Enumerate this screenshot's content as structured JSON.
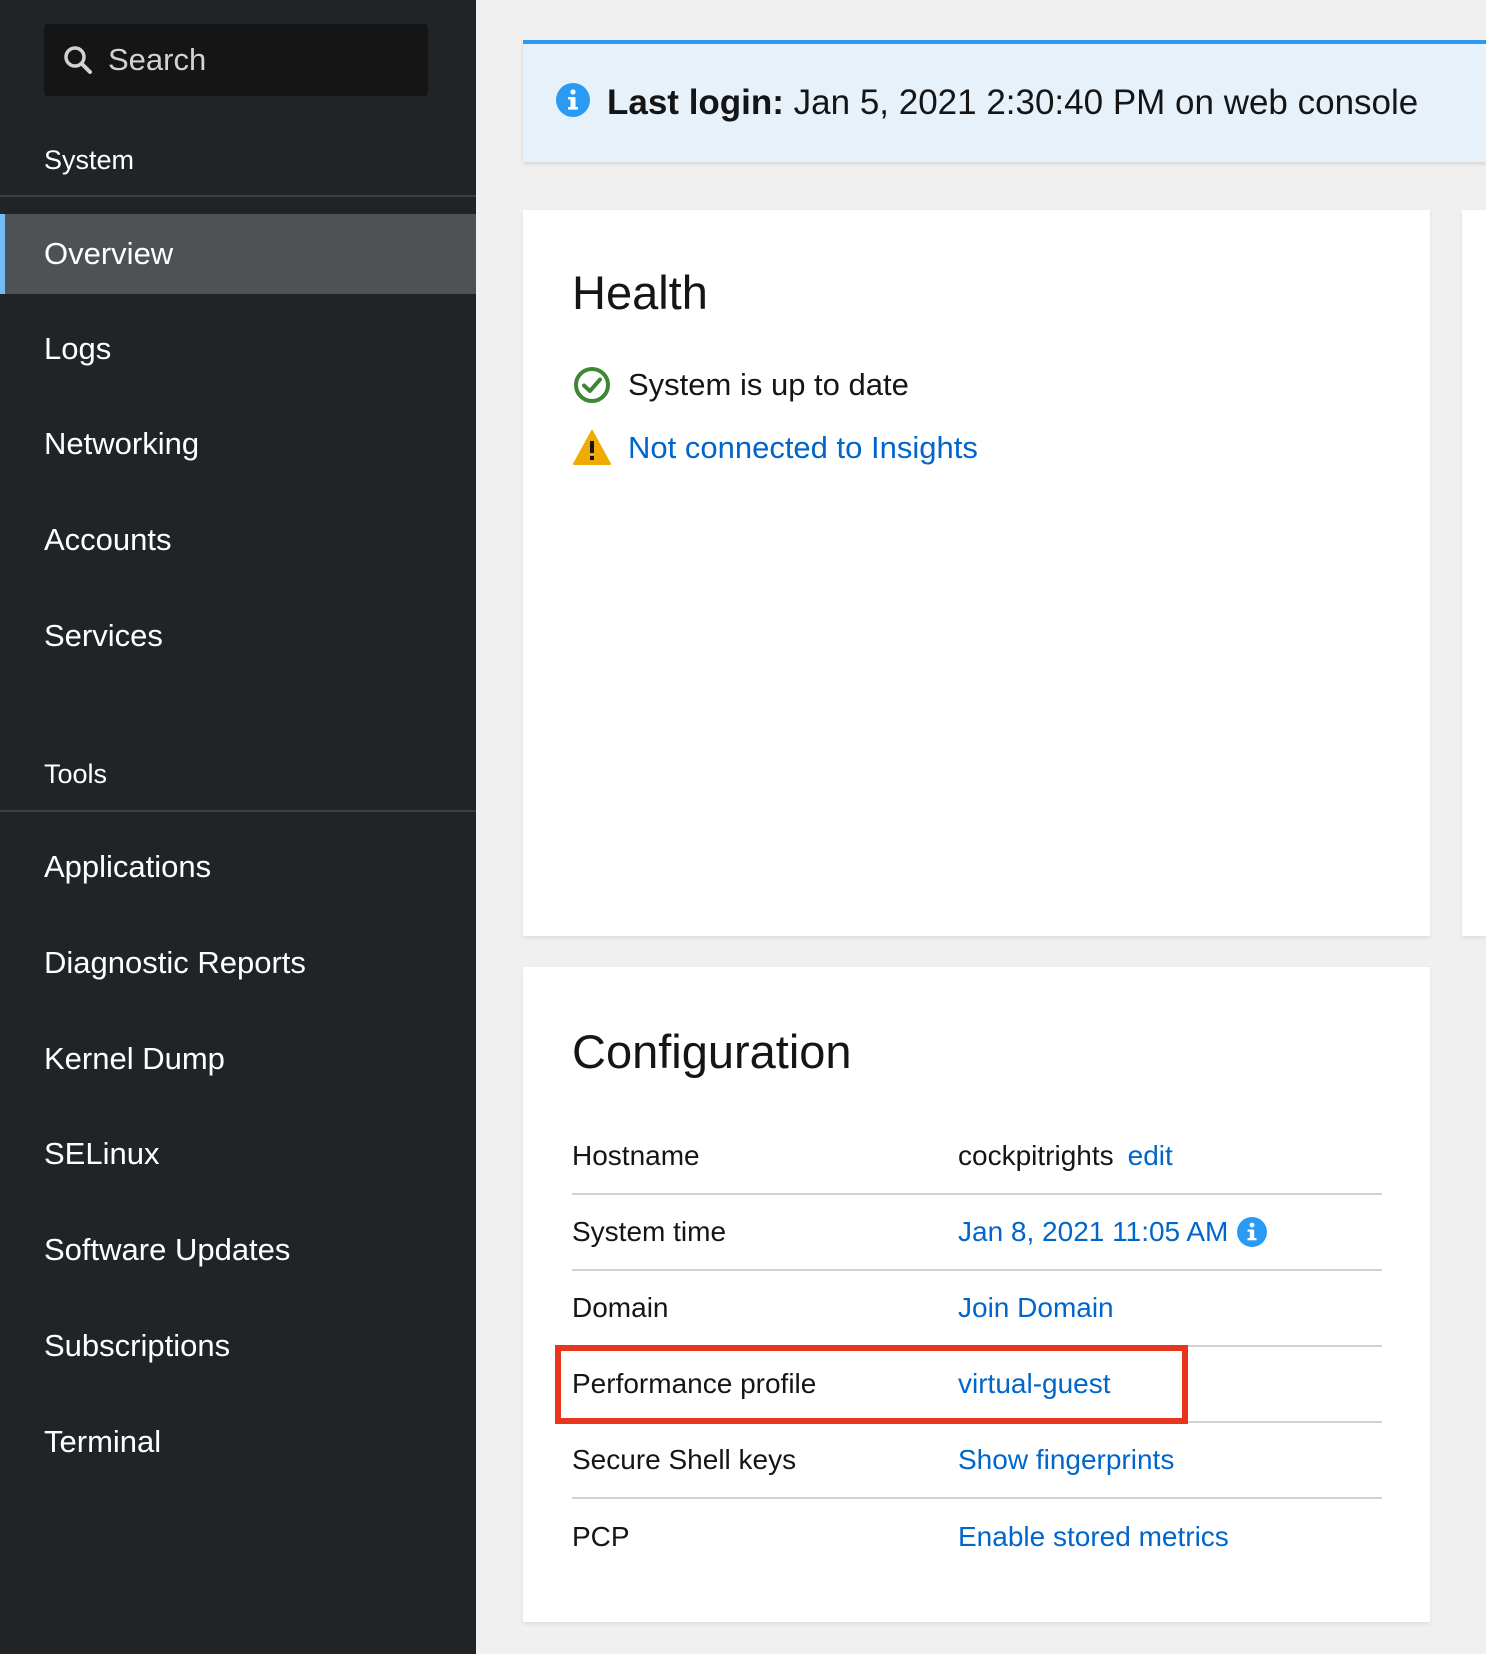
{
  "sidebar": {
    "search_placeholder": "Search",
    "section_system": "System",
    "section_tools": "Tools",
    "system_items": [
      "Overview",
      "Logs",
      "Networking",
      "Accounts",
      "Services"
    ],
    "tools_items": [
      "Applications",
      "Diagnostic Reports",
      "Kernel Dump",
      "SELinux",
      "Software Updates",
      "Subscriptions",
      "Terminal"
    ],
    "active_item": "Overview"
  },
  "alert": {
    "label": "Last login:",
    "message": " Jan 5, 2021 2:30:40 PM on web console"
  },
  "health": {
    "title": "Health",
    "status_ok": "System is up to date",
    "insights_link": "Not connected to Insights"
  },
  "configuration": {
    "title": "Configuration",
    "rows": {
      "hostname": {
        "label": "Hostname",
        "value": "cockpitrights",
        "action": "edit"
      },
      "system_time": {
        "label": "System time",
        "value": "Jan 8, 2021 11:05 AM"
      },
      "domain": {
        "label": "Domain",
        "value": "Join Domain"
      },
      "performance_profile": {
        "label": "Performance profile",
        "value": "virtual-guest"
      },
      "ssh_keys": {
        "label": "Secure Shell keys",
        "value": "Show fingerprints"
      },
      "pcp": {
        "label": "PCP",
        "value": "Enable stored metrics"
      }
    }
  },
  "colors": {
    "sidebar_bg": "#212427",
    "active_bg": "#4f5255",
    "active_accent": "#73bcf7",
    "link": "#0066cc",
    "success": "#3e8635",
    "warning": "#f0ab00",
    "info": "#2b9af3",
    "highlight": "#e8361e"
  }
}
